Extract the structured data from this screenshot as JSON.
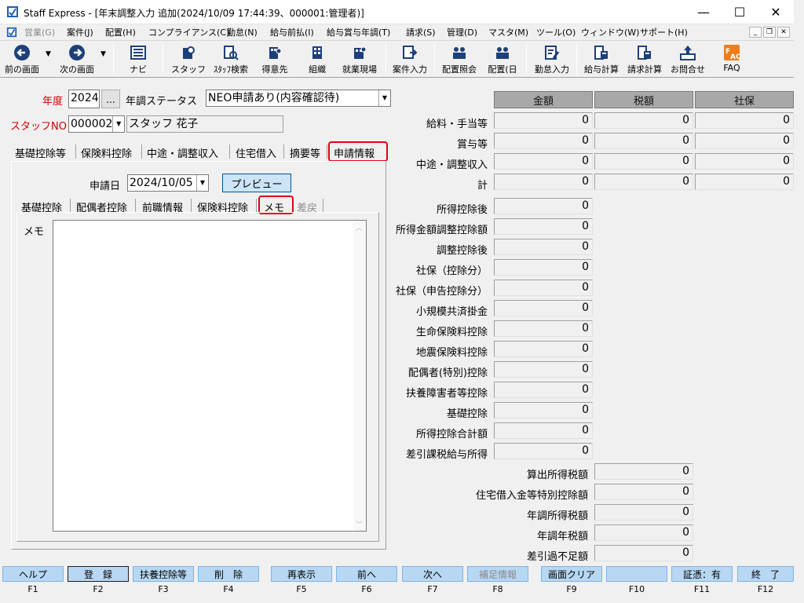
{
  "window": {
    "title": "Staff Express - [年末調整入力 追加(2024/10/09 17:44:39、000001:管理者)]",
    "minimize": "—",
    "maximize": "☐",
    "close": "✕"
  },
  "menu": [
    "営業(G)",
    "案件(J)",
    "配置(H)",
    "コンプライアンス(C)",
    "勤怠(N)",
    "給与前払(I)",
    "給与賞与年調(T)",
    "請求(S)",
    "管理(D)",
    "マスタ(M)",
    "ツール(O)",
    "ウィンドウ(W)",
    "サポート(H)"
  ],
  "mdi": {
    "minimize": "_",
    "restore": "❐",
    "close": "✕"
  },
  "toolbar": [
    {
      "label": "前の画面",
      "icon": "back-arrow-icon"
    },
    {
      "label": "次の画面",
      "icon": "forward-arrow-icon"
    },
    {
      "label": "ナビ",
      "icon": "navi-icon"
    },
    {
      "label": "スタッフ",
      "icon": "staff-icon"
    },
    {
      "label": "ｽﾀｯﾌ検索",
      "icon": "staff-search-icon"
    },
    {
      "label": "得意先",
      "icon": "customer-icon"
    },
    {
      "label": "組織",
      "icon": "organization-icon"
    },
    {
      "label": "就業現場",
      "icon": "workplace-icon"
    },
    {
      "label": "案件入力",
      "icon": "case-entry-icon"
    },
    {
      "label": "配置照会",
      "icon": "placement-inquiry-icon"
    },
    {
      "label": "配置(日",
      "icon": "placement-day-icon"
    },
    {
      "label": "勤怠入力",
      "icon": "attendance-entry-icon"
    },
    {
      "label": "給与計算",
      "icon": "payroll-calc-icon"
    },
    {
      "label": "請求計算",
      "icon": "billing-calc-icon"
    },
    {
      "label": "お問合せ",
      "icon": "inquiry-icon"
    },
    {
      "label": "FAQ",
      "icon": "faq-icon"
    }
  ],
  "form": {
    "year_label": "年度",
    "year_value": "2024",
    "year_button": "...",
    "status_label": "年調ステータス",
    "status_value": "NEO申請あり(内容確認待)",
    "staff_no_label": "スタッフNO",
    "staff_no_value": "000002",
    "staff_name": "スタッフ 花子"
  },
  "tabs": [
    "基礎控除等",
    "保険料控除",
    "中途・調整収入",
    "住宅借入",
    "摘要等",
    "申請情報"
  ],
  "apply": {
    "date_label": "申請日",
    "date_value": "2024/10/05",
    "preview_button": "プレビュー"
  },
  "subtabs": [
    "基礎控除",
    "配偶者控除",
    "前職情報",
    "保険料控除",
    "メモ",
    "差戻"
  ],
  "memo_label": "メモ",
  "memo_value": "",
  "right": {
    "headers": [
      "金額",
      "税額",
      "社保"
    ],
    "income_rows": [
      {
        "label": "給料・手当等",
        "values": [
          "0",
          "0",
          "0"
        ]
      },
      {
        "label": "賞与等",
        "values": [
          "0",
          "0",
          "0"
        ]
      },
      {
        "label": "中途・調整収入",
        "values": [
          "0",
          "0",
          "0"
        ]
      },
      {
        "label": "計",
        "values": [
          "0",
          "0",
          "0"
        ]
      }
    ],
    "deduction_rows": [
      {
        "label": "所得控除後",
        "value": "0"
      },
      {
        "label": "所得金額調整控除額",
        "value": "0"
      },
      {
        "label": "調整控除後",
        "value": "0"
      },
      {
        "label": "社保（控除分）",
        "value": "0"
      },
      {
        "label": "社保（申告控除分）",
        "value": "0"
      },
      {
        "label": "小規模共済掛金",
        "value": "0"
      },
      {
        "label": "生命保険料控除",
        "value": "0"
      },
      {
        "label": "地震保険料控除",
        "value": "0"
      },
      {
        "label": "配偶者(特別)控除",
        "value": "0"
      },
      {
        "label": "扶養障害者等控除",
        "value": "0"
      },
      {
        "label": "基礎控除",
        "value": "0"
      },
      {
        "label": "所得控除合計額",
        "value": "0"
      },
      {
        "label": "差引課税給与所得",
        "value": "0"
      }
    ],
    "tax_rows": [
      {
        "label": "算出所得税額",
        "value": "0"
      },
      {
        "label": "住宅借入金等特別控除額",
        "value": "0"
      },
      {
        "label": "年調所得税額",
        "value": "0"
      },
      {
        "label": "年調年税額",
        "value": "0"
      },
      {
        "label": "差引過不足額",
        "value": "0"
      }
    ]
  },
  "fkeys": [
    {
      "label": "ヘルプ",
      "key": "F1",
      "enabled": true
    },
    {
      "label": "登　録",
      "key": "F2",
      "enabled": true
    },
    {
      "label": "扶養控除等",
      "key": "F3",
      "enabled": true
    },
    {
      "label": "削　除",
      "key": "F4",
      "enabled": true
    },
    {
      "label": "再表示",
      "key": "F5",
      "enabled": true
    },
    {
      "label": "前へ",
      "key": "F6",
      "enabled": true
    },
    {
      "label": "次へ",
      "key": "F7",
      "enabled": true
    },
    {
      "label": "補足情報",
      "key": "F8",
      "enabled": false
    },
    {
      "label": "画面クリア",
      "key": "F9",
      "enabled": true
    },
    {
      "label": "",
      "key": "F10",
      "enabled": true
    },
    {
      "label": "証憑：有",
      "key": "F11",
      "enabled": true
    },
    {
      "label": "終　了",
      "key": "F12",
      "enabled": true
    }
  ],
  "colors": {
    "highlight": "#e0001a",
    "header_gray": "#a8a8a8",
    "fkey_blue": "#b7d7f2",
    "preview_blue": "#cce4f7",
    "label_red": "#d00000"
  }
}
